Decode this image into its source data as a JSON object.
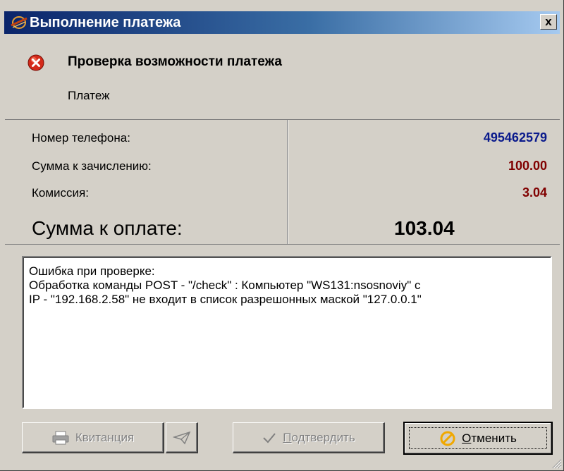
{
  "window": {
    "title": "Выполнение платежа",
    "close_label": "x"
  },
  "header": {
    "icon": "error-icon",
    "title": "Проверка возможности платежа",
    "subtitle": "Платеж"
  },
  "summary": {
    "rows": [
      {
        "label": "Номер телефона:",
        "value": "495462579",
        "color": "#0a1a8c"
      },
      {
        "label": "Сумма к зачислению:",
        "value": "100.00",
        "color": "#800000"
      },
      {
        "label": "Комиссия:",
        "value": "3.04",
        "color": "#800000"
      }
    ],
    "total_label": "Сумма к оплате:",
    "total_value": "103.04"
  },
  "message": {
    "lines": [
      "Ошибка при проверке:",
      "Обработка команды POST - \"/check\" : Компьютер \"WS131:nsosnoviy\" с",
      "IP - \"192.168.2.58\" не входит в список разрешонных маской \"127.0.0.1\""
    ]
  },
  "buttons": {
    "receipt": {
      "label": "Квитанция",
      "icon": "printer-icon",
      "enabled": false
    },
    "send": {
      "icon": "paper-plane-icon",
      "enabled": false
    },
    "confirm": {
      "label_underlined": "П",
      "label_rest": "одтвердить",
      "icon": "checkmark-icon",
      "enabled": false
    },
    "cancel": {
      "label_underlined": "О",
      "label_rest": "тменить",
      "icon": "cancel-icon",
      "enabled": true
    }
  }
}
